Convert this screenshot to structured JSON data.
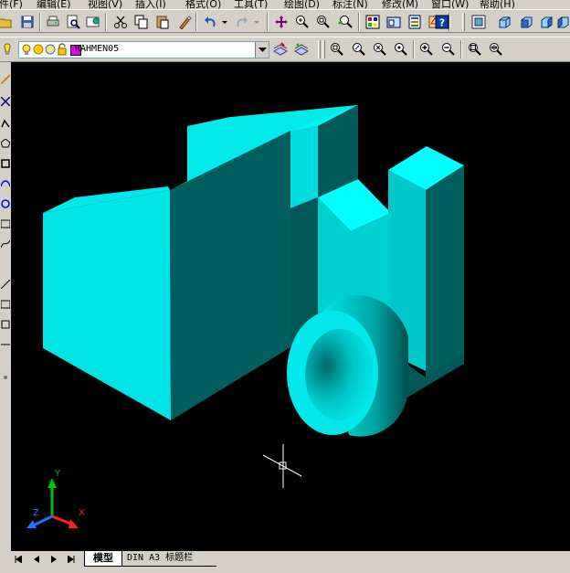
{
  "menu": {
    "items": [
      "件(F)",
      "编辑(E)",
      "视图(V)",
      "插入(I)",
      "格式(O)",
      "工具(T)",
      "绘图(D)",
      "标注(N)",
      "修改(M)",
      "窗口(W)",
      "帮助(H)"
    ]
  },
  "layer": {
    "current": "RAHMEN05",
    "color": "#e000e0"
  },
  "tabs": {
    "model": "模型",
    "layout": "DIN A3 标题栏"
  },
  "ucs": {
    "y": "Y",
    "x": "X",
    "z": "Z"
  },
  "colors": {
    "model_light": "#00e4e6",
    "model_mid": "#00c7c8",
    "model_dark": "#005e5e",
    "model_top": "#00ffff",
    "viewport_bg": "#000000"
  }
}
